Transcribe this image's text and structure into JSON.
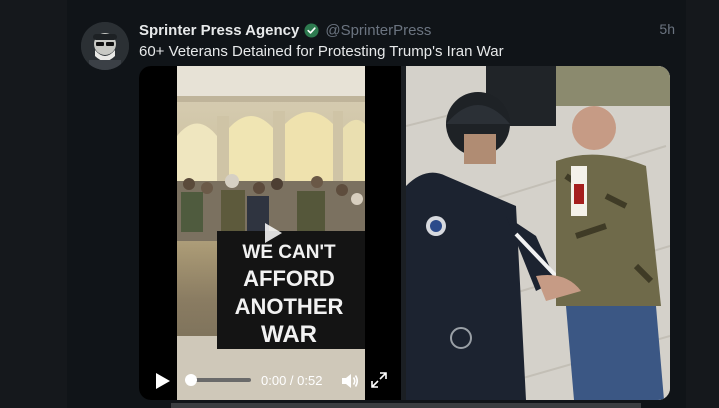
{
  "post": {
    "author_name": "Sprinter Press Agency",
    "handle": "@SprinterPress",
    "timestamp": "5h",
    "text": "60+ Veterans Detained for Protesting Trump's Iran War"
  },
  "video": {
    "banner_lines": [
      "WE CAN'T",
      "AFFORD",
      "ANOTHER",
      "WAR"
    ],
    "time": "0:00 / 0:52",
    "progress": 0.0
  },
  "icons": {
    "verified": "verified-badge-icon",
    "play": "play-icon",
    "volume": "volume-icon",
    "fullscreen": "fullscreen-icon"
  },
  "colors": {
    "background": "#15181c",
    "panel": "#101418",
    "text": "#e7e9ea",
    "muted": "#6b7480",
    "verified": "#1d9bf0"
  }
}
